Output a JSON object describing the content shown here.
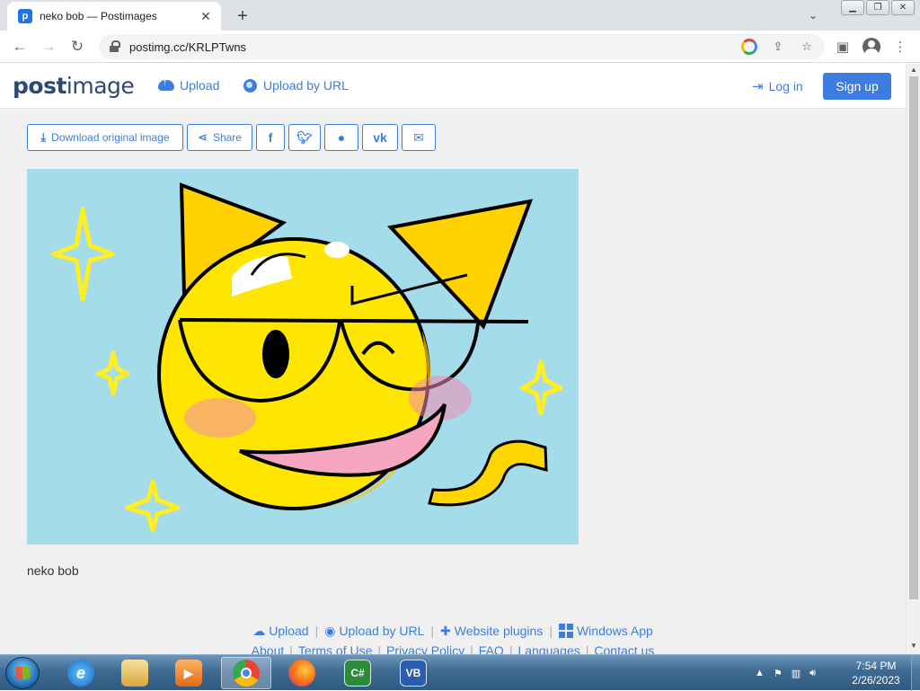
{
  "browser": {
    "tab_title": "neko bob — Postimages",
    "url": "postimg.cc/KRLPTwns"
  },
  "site": {
    "logo_bold": "post",
    "logo_rest": "image",
    "nav": {
      "upload": "Upload",
      "upload_by_url": "Upload by URL",
      "login": "Log in",
      "signup": "Sign up"
    },
    "share_bar": {
      "download": "Download original image",
      "share": "Share"
    },
    "image": {
      "caption": "neko bob"
    },
    "footer": {
      "row1": [
        "Upload",
        "Upload by URL",
        "Website plugins",
        "Windows App"
      ],
      "row2": [
        "About",
        "Terms of Use",
        "Privacy Policy",
        "FAQ",
        "Languages",
        "Contact us"
      ]
    },
    "colors": {
      "accent": "#3d7de0",
      "logo": "#2b4a73",
      "image_bg": "#a4dcea",
      "face": "#ffe600"
    }
  },
  "taskbar": {
    "time": "7:54 PM",
    "date": "2/26/2023",
    "apps": [
      "internet-explorer",
      "file-explorer",
      "media-player",
      "chrome",
      "firefox",
      "csharp",
      "visual-basic"
    ]
  }
}
